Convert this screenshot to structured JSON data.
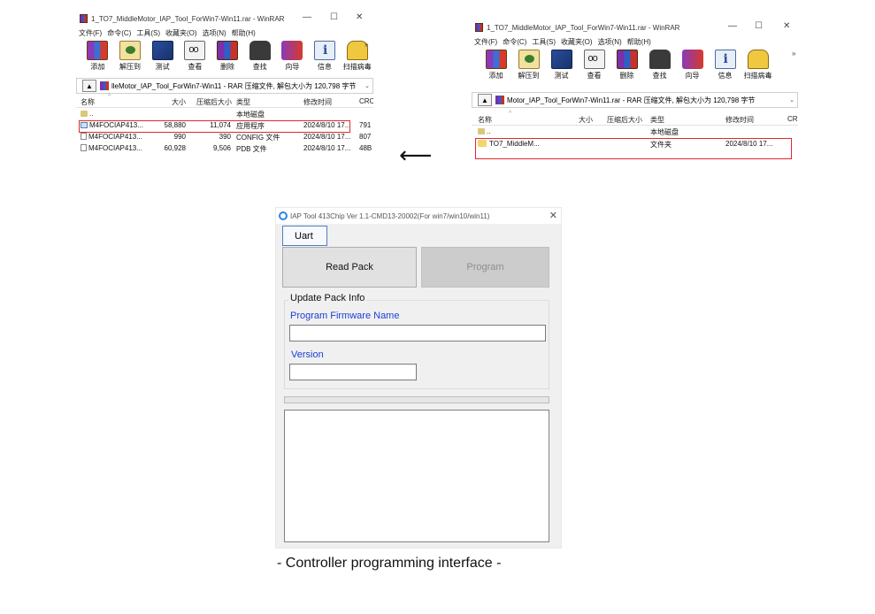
{
  "left_window": {
    "title": "1_TO7_MiddleMotor_IAP_Tool_ForWin7-Win11.rar - WinRAR",
    "menu": [
      "文件(F)",
      "命令(C)",
      "工具(S)",
      "收藏夹(O)",
      "选项(N)",
      "帮助(H)"
    ],
    "toolbar": [
      {
        "label": "添加",
        "icon": "add-icon"
      },
      {
        "label": "解压到",
        "icon": "extract-icon"
      },
      {
        "label": "测试",
        "icon": "test-icon"
      },
      {
        "label": "查看",
        "icon": "view-icon"
      },
      {
        "label": "删除",
        "icon": "delete-icon"
      },
      {
        "label": "查找",
        "icon": "find-icon"
      },
      {
        "label": "向导",
        "icon": "wizard-icon"
      },
      {
        "label": "信息",
        "icon": "info-icon"
      },
      {
        "label": "扫描病毒",
        "icon": "virus-scan-icon"
      }
    ],
    "path": "lleMotor_IAP_Tool_ForWin7-Win11 - RAR 压缩文件, 解包大小为 120,798 字节",
    "columns": [
      "名称",
      "大小",
      "压缩后大小",
      "类型",
      "修改时间",
      "CRC"
    ],
    "rows": [
      {
        "name": "..",
        "size": "",
        "packed": "",
        "type": "本地磁盘",
        "modified": "",
        "crc": ""
      },
      {
        "name": "M4FOCIAP413...",
        "size": "58,880",
        "packed": "11,074",
        "type": "应用程序",
        "modified": "2024/8/10 17...",
        "crc": "791"
      },
      {
        "name": "M4FOCIAP413...",
        "size": "990",
        "packed": "390",
        "type": "CONFIG 文件",
        "modified": "2024/8/10 17...",
        "crc": "807"
      },
      {
        "name": "M4FOCIAP413...",
        "size": "60,928",
        "packed": "9,506",
        "type": "PDB 文件",
        "modified": "2024/8/10 17...",
        "crc": "48B"
      }
    ]
  },
  "right_window": {
    "title": "1_TO7_MiddleMotor_IAP_Tool_ForWin7-Win11.rar - WinRAR",
    "menu": [
      "文件(F)",
      "命令(C)",
      "工具(S)",
      "收藏夹(O)",
      "选项(N)",
      "帮助(H)"
    ],
    "toolbar": [
      {
        "label": "添加",
        "icon": "add-icon"
      },
      {
        "label": "解压到",
        "icon": "extract-icon"
      },
      {
        "label": "测试",
        "icon": "test-icon"
      },
      {
        "label": "查看",
        "icon": "view-icon"
      },
      {
        "label": "删除",
        "icon": "delete-icon"
      },
      {
        "label": "查找",
        "icon": "find-icon"
      },
      {
        "label": "向导",
        "icon": "wizard-icon"
      },
      {
        "label": "信息",
        "icon": "info-icon"
      },
      {
        "label": "扫描病毒",
        "icon": "virus-scan-icon"
      }
    ],
    "path": "Motor_IAP_Tool_ForWin7-Win11.rar - RAR 压缩文件, 解包大小为 120,798 字节",
    "columns": [
      "名称",
      "大小",
      "压缩后大小",
      "类型",
      "修改时间",
      "CR"
    ],
    "rows": [
      {
        "name": "..",
        "size": "",
        "packed": "",
        "type": "本地磁盘",
        "modified": "",
        "crc": ""
      },
      {
        "name": "TO7_MiddleM...",
        "size": "",
        "packed": "",
        "type": "文件夹",
        "modified": "2024/8/10 17...",
        "crc": ""
      }
    ]
  },
  "arrow_symbol": "⟵",
  "iap_tool": {
    "title": "IAP Tool 413Chip Ver 1.1-CMD13-20002(For win7/win10/win11)",
    "close_symbol": "✕",
    "tab_label": "Uart",
    "read_pack_label": "Read Pack",
    "program_label": "Program",
    "group_title": "Update Pack Info",
    "firmware_label": "Program Firmware Name",
    "firmware_value": "",
    "version_label": "Version",
    "version_value": "",
    "progress": 0,
    "log": ""
  },
  "caption": "- Controller programming interface -",
  "colors": {
    "highlight_box": "#e0282e",
    "field_label": "#1c3fd6",
    "dialog_bg": "#f0f0f0"
  }
}
